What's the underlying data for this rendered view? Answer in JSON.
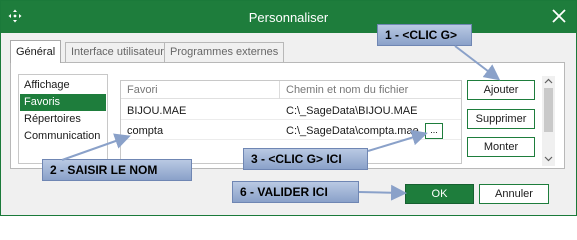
{
  "window": {
    "title": "Personnaliser",
    "accent": "#1e7d3c"
  },
  "tabs": [
    {
      "label": "Général",
      "active": true
    },
    {
      "label": "Interface utilisateur",
      "active": false
    },
    {
      "label": "Programmes externes",
      "active": false
    }
  ],
  "nav": {
    "items": [
      "Affichage",
      "Favoris",
      "Répertoires",
      "Communication"
    ],
    "selected": "Favoris"
  },
  "grid": {
    "headers": [
      "Favori",
      "Chemin et nom du fichier"
    ],
    "rows": [
      {
        "name": "BIJOU.MAE",
        "path": "C:\\_SageData\\BIJOU.MAE"
      },
      {
        "name": "compta",
        "path": "C:\\_SageData\\compta.mae"
      }
    ],
    "browse_label": "..."
  },
  "buttons": {
    "add": "Ajouter",
    "delete": "Supprimer",
    "up": "Monter",
    "ok": "OK",
    "cancel": "Annuler"
  },
  "annotations": {
    "step1": "1 - <CLIC G>",
    "step2": "2 - SAISIR LE NOM",
    "step3": "3 - <CLIC G> ICI",
    "step6": "6 - VALIDER ICI",
    "color": "#9fb4d8"
  },
  "icons": {
    "title_left": "move-icon",
    "title_right": "close-icon"
  }
}
